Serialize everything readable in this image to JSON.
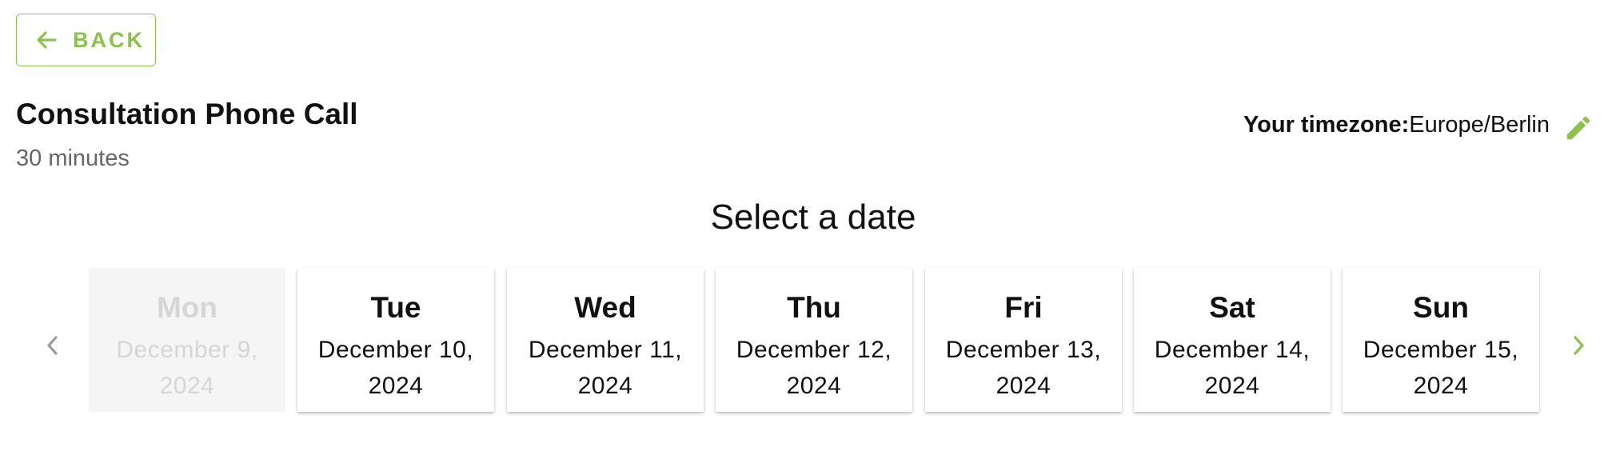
{
  "back_button": {
    "label": "BACK",
    "icon": "arrow-left-icon"
  },
  "event": {
    "title": "Consultation Phone Call",
    "duration": "30 minutes"
  },
  "timezone": {
    "label": "Your timezone:",
    "value": "Europe/Berlin",
    "edit_icon": "pencil-icon"
  },
  "section_title": "Select a date",
  "navigation": {
    "prev_icon": "chevron-left-icon",
    "next_icon": "chevron-right-icon"
  },
  "days": [
    {
      "dow": "Mon",
      "date": "December 9, 2024",
      "available": false
    },
    {
      "dow": "Tue",
      "date": "December 10, 2024",
      "available": true
    },
    {
      "dow": "Wed",
      "date": "December 11, 2024",
      "available": true
    },
    {
      "dow": "Thu",
      "date": "December 12, 2024",
      "available": true
    },
    {
      "dow": "Fri",
      "date": "December 13, 2024",
      "available": true
    },
    {
      "dow": "Sat",
      "date": "December 14, 2024",
      "available": true
    },
    {
      "dow": "Sun",
      "date": "December 15, 2024",
      "available": true
    }
  ],
  "colors": {
    "accent": "#8bc34a",
    "disabled_text": "#d6d6d6",
    "muted_text": "#666666",
    "nav_prev": "#9e9e9e"
  }
}
